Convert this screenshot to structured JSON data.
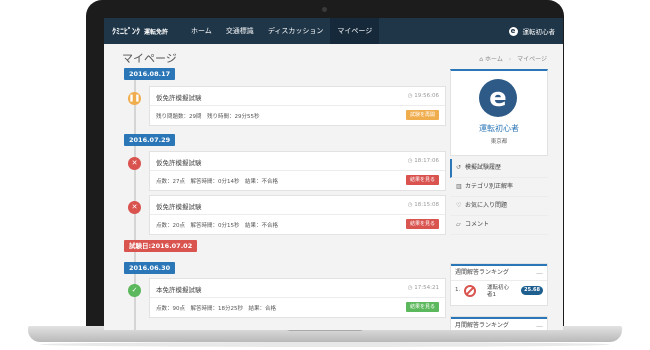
{
  "navbar": {
    "logo": "ｸﾐﾆﾋﾟﾝｸ",
    "logo_sub": "運転免許",
    "items": [
      "ホーム",
      "交通標識",
      "ディスカッション",
      "マイページ"
    ],
    "user_name": "運転初心者"
  },
  "page": {
    "title": "マイページ",
    "breadcrumb": [
      "ホーム",
      "マイページ"
    ]
  },
  "timeline": {
    "dates": [
      "2016.08.17",
      "2016.07.29",
      "試験日:2016.07.02",
      "2016.06.30"
    ],
    "entries": [
      {
        "title": "仮免許模擬試験",
        "time": "19:56:06",
        "info": "残り問題数：29問　残り時間：29分55秒",
        "button": "試験を再開",
        "status": "paused"
      },
      {
        "title": "仮免許模擬試験",
        "time": "18:17:06",
        "info": "点数：27点　解答時間：0分14秒　結果：不合格",
        "button": "結果を見る",
        "status": "failed"
      },
      {
        "title": "仮免許模擬試験",
        "time": "18:15:08",
        "info": "点数：20点　解答時間：0分15秒　結果：不合格",
        "button": "結果を見る",
        "status": "failed"
      },
      {
        "title": "本免許模擬試験",
        "time": "17:54:21",
        "info": "点数：90点　解答時間：18分25秒　結果：合格",
        "button": "結果を見る",
        "status": "passed"
      }
    ]
  },
  "profile": {
    "name": "運転初心者",
    "location": "東京都"
  },
  "menu": [
    {
      "label": "模擬試験履歴",
      "icon": "history-icon"
    },
    {
      "label": "カテゴリ別正解率",
      "icon": "bar-chart-icon"
    },
    {
      "label": "お気に入り問題",
      "icon": "heart-icon"
    },
    {
      "label": "コメント",
      "icon": "comment-icon"
    }
  ],
  "ranking": {
    "weekly_title": "週間解答ランキング",
    "rank": "1.",
    "name": "運転初心者1",
    "score": "25.68",
    "monthly_title": "月間解答ランキング"
  },
  "colors": {
    "navbar": "#1f3649",
    "accent": "#2b76b6",
    "danger": "#d9534f",
    "warning": "#f0ad4e",
    "success": "#5cb85c"
  }
}
